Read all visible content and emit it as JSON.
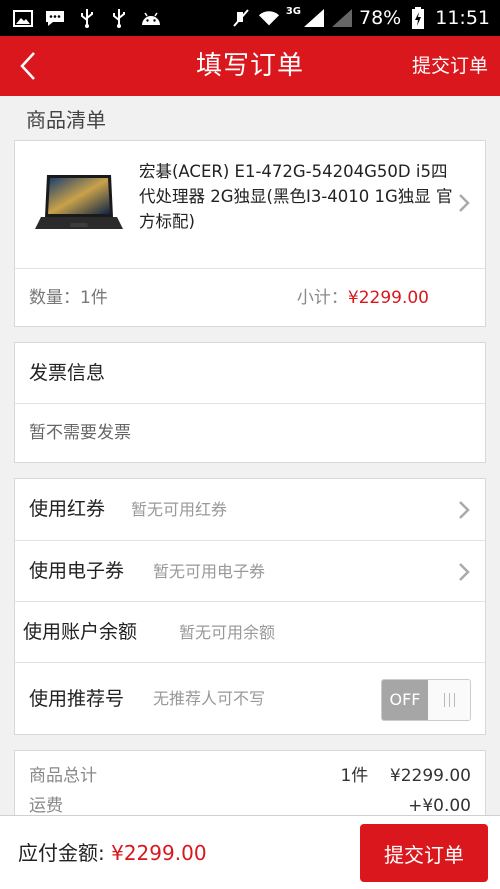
{
  "status_bar": {
    "battery": "78%",
    "time": "11:51",
    "network": "3G",
    "icons": [
      "image-icon",
      "message-icon",
      "usb-icon",
      "usb-icon",
      "android-icon",
      "mute-icon",
      "wifi-icon",
      "signal-icon",
      "signal-icon",
      "battery-icon"
    ]
  },
  "header": {
    "title": "填写订单",
    "submit": "提交订单"
  },
  "product_section": {
    "label": "商品清单",
    "name": "宏碁(ACER) E1-472G-54204G50D i5四代处理器 2G独显(黑色I3-4010 1G独显 官方标配)",
    "quantity": "数量：1件",
    "subtotal_label": "小计：",
    "subtotal_value": "¥2299.00"
  },
  "invoice": {
    "title": "发票信息",
    "value": "暂不需要发票"
  },
  "options": [
    {
      "label": "使用红券",
      "hint": "暂无可用红券"
    },
    {
      "label": "使用电子券",
      "hint": "暂无可用电子券"
    },
    {
      "label": "使用账户余额",
      "hint": "暂无可用余额"
    },
    {
      "label": "使用推荐号",
      "hint": "无推荐人可不写",
      "toggle": "OFF"
    }
  ],
  "summary": {
    "goods_label": "商品总计",
    "goods_value": "1件    ¥2299.00",
    "shipping_label": "运费",
    "shipping_value": "+¥0.00"
  },
  "footer": {
    "payable_label": "应付金额:",
    "payable_value": "¥2299.00",
    "submit": "提交订单"
  },
  "colors": {
    "brand_red": "#d9171d",
    "status_bar": "#000000",
    "background": "#f1f1f1"
  }
}
